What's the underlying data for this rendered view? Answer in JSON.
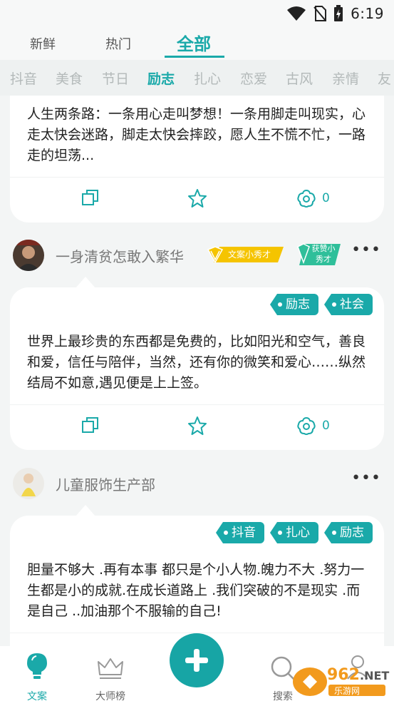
{
  "status": {
    "time": "6:19"
  },
  "top_tabs": [
    {
      "label": "新鲜"
    },
    {
      "label": "热门"
    },
    {
      "label": "全部",
      "active": true
    }
  ],
  "categories": [
    "抖音",
    "美食",
    "节日",
    "励志",
    "扎心",
    "恋爱",
    "古风",
    "亲情",
    "友"
  ],
  "active_category": "励志",
  "cards": [
    {
      "text": "人生两条路：一条用心走叫梦想！一条用脚走叫现实，心走太快会迷路，脚走太快会摔跤，愿人生不慌不忙，一路走的坦荡...",
      "like_count": "0"
    },
    {
      "user": {
        "name": "一身清贫怎敢入繁华",
        "badge1": "文案小秀才",
        "badge2_line1": "获赞小",
        "badge2_line2": "秀才"
      },
      "tags": [
        "励志",
        "社会"
      ],
      "text": "世界上最珍贵的东西都是免费的，比如阳光和空气，善良和爱，信任与陪伴，当然，还有你的微笑和爱心……纵然结局不如意,遇见便是上上签。",
      "like_count": "0"
    },
    {
      "user": {
        "name": "儿童服饰生产部"
      },
      "tags": [
        "抖音",
        "扎心",
        "励志"
      ],
      "text": "胆量不够大 .再有本事 都只是个小人物.魄力不大 .努力一生都是小的成就.在成长道路上 .我们突破的不是现实 .而是自己 ..加油那个不服输的自己!"
    }
  ],
  "more_label": "•••",
  "bottom_nav": [
    {
      "label": "文案",
      "active": true
    },
    {
      "label": "大师榜"
    },
    {
      "label": "搜索"
    },
    {
      "label": ""
    }
  ],
  "watermark": {
    "brand": "962",
    "suffix": ".NET",
    "sub": "乐游网"
  },
  "colors": {
    "accent": "#1aa9a9",
    "badge_yellow": "#f5c400"
  }
}
